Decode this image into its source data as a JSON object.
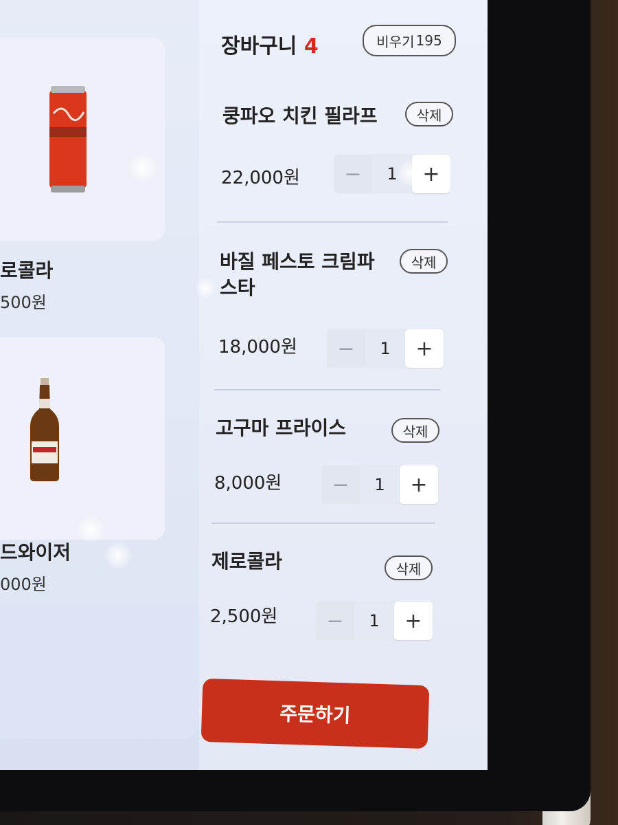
{
  "left_panel": {
    "products": [
      {
        "name": "로콜라",
        "price": "500원"
      },
      {
        "name": "드와이저",
        "price": "000원"
      }
    ]
  },
  "cart": {
    "title": "장바구니",
    "count": "4",
    "clear_label": "비우기",
    "clear_extra": "195",
    "delete_label": "삭제",
    "items": [
      {
        "name": "쿵파오 치킨 필라프",
        "price": "22,000원",
        "qty": "1"
      },
      {
        "name": "바질 페스토 크림파스타",
        "price": "18,000원",
        "qty": "1"
      },
      {
        "name": "고구마 프라이스",
        "price": "8,000원",
        "qty": "1"
      },
      {
        "name": "제로콜라",
        "price": "2,500원",
        "qty": "1"
      }
    ],
    "minus_symbol": "−",
    "plus_symbol": "+",
    "order_label": "주문하기"
  },
  "colors": {
    "accent": "#d72a1e",
    "order_button": "#c9301c"
  }
}
